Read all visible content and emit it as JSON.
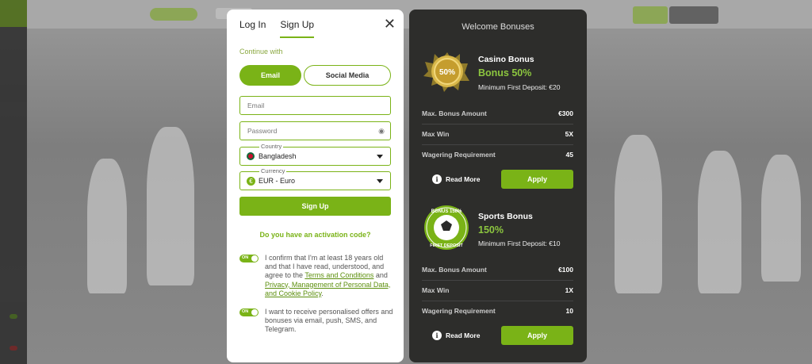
{
  "colors": {
    "accent": "#7ab317",
    "panel_dark": "#2d2d2b",
    "bonus_value": "#8cc63f"
  },
  "signup": {
    "tabs": [
      {
        "label": "Log In"
      },
      {
        "label": "Sign Up"
      }
    ],
    "close_icon": "close-icon",
    "continue_with": "Continue with",
    "methods": {
      "email": "Email",
      "social": "Social Media"
    },
    "email_placeholder": "Email",
    "password_placeholder": "Password",
    "country": {
      "legend": "Country",
      "value": "Bangladesh"
    },
    "currency": {
      "legend": "Currency",
      "value": "EUR - Euro"
    },
    "submit": "Sign Up",
    "activation": "Do you have an activation code?",
    "toggle_on": "ON",
    "consent1": {
      "before": "I confirm that I'm at least 18 years old and that I have read, understood, and agree to the ",
      "link1": "Terms and Conditions",
      "middle": " and ",
      "link2": "Privacy, Management of Personal Data, and Cookie Policy",
      "after": "."
    },
    "consent2": "I want to receive personalised offers and bonuses via email, push, SMS, and Telegram."
  },
  "bonuses": {
    "title": "Welcome Bonuses",
    "read_more": "Read More",
    "apply": "Apply",
    "casino": {
      "badge_text": "50%",
      "title": "Casino Bonus",
      "value": "Bonus 50%",
      "min_deposit": "Minimum First Deposit: €20",
      "rows": [
        {
          "label": "Max. Bonus Amount",
          "value": "€300"
        },
        {
          "label": "Max Win",
          "value": "5X"
        },
        {
          "label": "Wagering Requirement",
          "value": "45"
        }
      ]
    },
    "sports": {
      "badge_top": "BONUS 150%",
      "badge_bottom": "FIRST DEPOSIT",
      "title": "Sports Bonus",
      "value": "150%",
      "min_deposit": "Minimum First Deposit: €10",
      "rows": [
        {
          "label": "Max. Bonus Amount",
          "value": "€100"
        },
        {
          "label": "Max Win",
          "value": "1X"
        },
        {
          "label": "Wagering Requirement",
          "value": "10"
        }
      ]
    }
  }
}
